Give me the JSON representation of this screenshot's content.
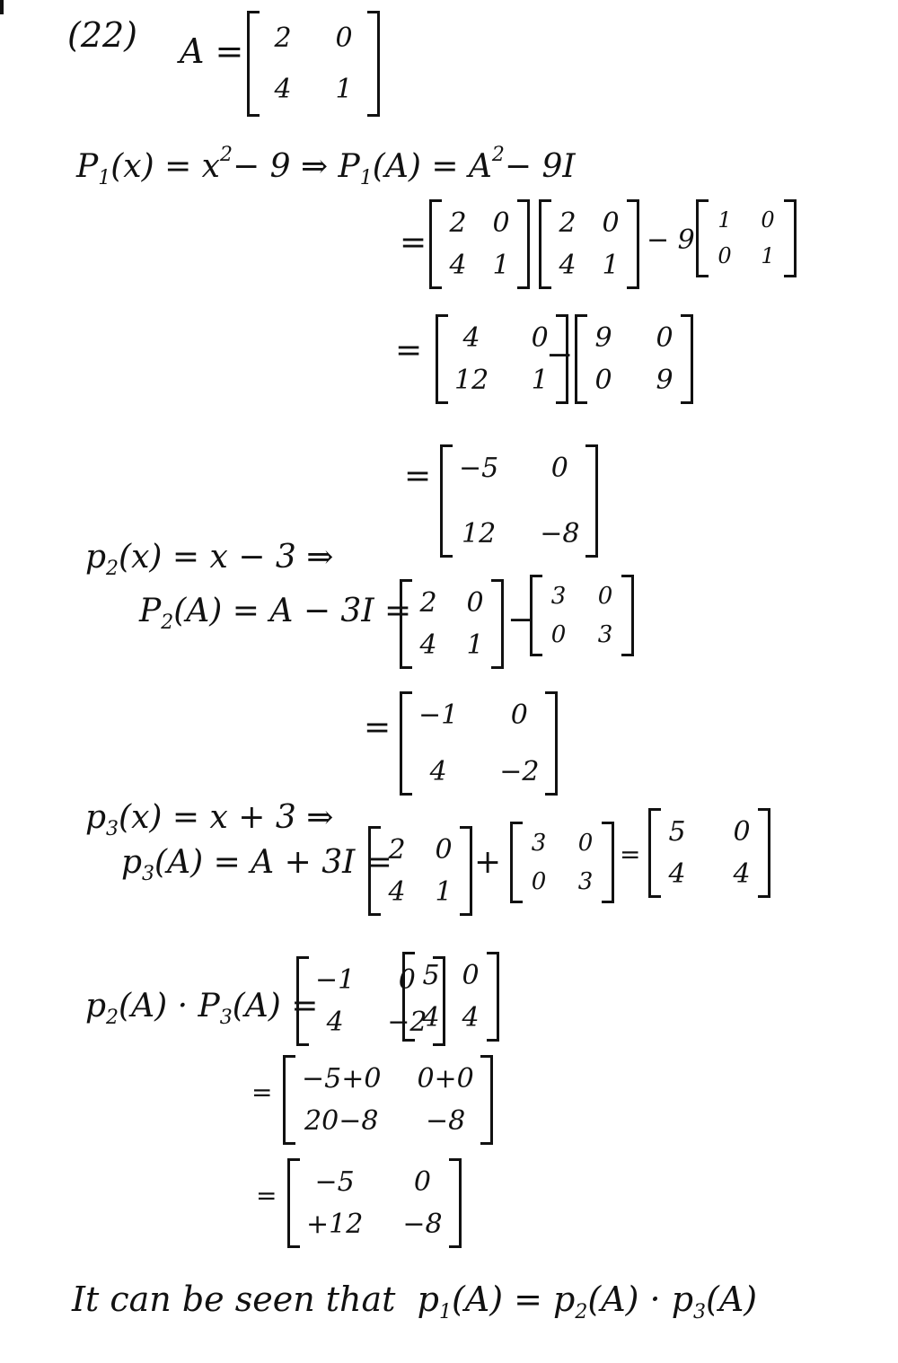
{
  "problem_number": "(22)",
  "matrix_A": {
    "label": "A =",
    "cells": [
      "2",
      "0",
      "4",
      "1"
    ]
  },
  "p1": {
    "definition_lhs": "P",
    "definition_sub": "1",
    "definition_rest": "(x) = x",
    "definition_sup": "2",
    "definition_tail": "− 9  ⇒  P",
    "pa_sub": "1",
    "pa_rest": "(A) = A",
    "pa_sup": "2",
    "pa_tail": "− 9I",
    "step1": {
      "eq": "=",
      "m1": [
        "2",
        "0",
        "4",
        "1"
      ],
      "m2": [
        "2",
        "0",
        "4",
        "1"
      ],
      "op": "− 9",
      "m3": [
        "1",
        "0",
        "0",
        "1"
      ]
    },
    "step2": {
      "eq": "=",
      "m1": [
        "4",
        "0",
        "12",
        "1"
      ],
      "op": "−",
      "m2": [
        "9",
        "0",
        "0",
        "9"
      ]
    },
    "step3": {
      "eq": "=",
      "m1": [
        "−5",
        "0",
        "12",
        "−8"
      ]
    }
  },
  "p2": {
    "definition_sym": "p",
    "definition_sub": "2",
    "definition_rest": "(x) = x − 3 ⇒",
    "pa_sym": "P",
    "pa_sub": "2",
    "pa_rest": "(A) = A − 3I =",
    "m1": [
      "2",
      "0",
      "4",
      "1"
    ],
    "op": "−",
    "m2": [
      "3",
      "0",
      "0",
      "3"
    ],
    "result_eq": "=",
    "result": [
      "−1",
      "0",
      "4",
      "−2"
    ]
  },
  "p3": {
    "definition_sym": "p",
    "definition_sub": "3",
    "definition_rest": "(x) = x + 3 ⇒",
    "pa_sym": "p",
    "pa_sub": "3",
    "pa_rest": "(A) = A + 3I =",
    "m1": [
      "2",
      "0",
      "4",
      "1"
    ],
    "op": "+",
    "m2": [
      "3",
      "0",
      "0",
      "3"
    ],
    "result_eq": "=",
    "result": [
      "5",
      "0",
      "4",
      "4"
    ]
  },
  "product": {
    "lhs_a": "p",
    "lhs_a_sub": "2",
    "lhs_mid": "(A) · P",
    "lhs_b_sub": "3",
    "lhs_end": "(A) =",
    "m1": [
      "−1",
      "0",
      "4",
      "−2"
    ],
    "m2": [
      "5",
      "0",
      "4",
      "4"
    ],
    "step1_eq": "=",
    "step1": [
      "−5+0",
      "0+0",
      "20−8",
      "−8"
    ],
    "step2_eq": "=",
    "step2": [
      "−5",
      "0",
      "+12",
      "−8"
    ]
  },
  "conclusion": {
    "text": "It can be seen that",
    "p1": "p",
    "p1_sub": "1",
    "mid1": "(A) = p",
    "p2_sub": "2",
    "mid2": "(A) · p",
    "p3_sub": "3",
    "end": "(A)"
  }
}
